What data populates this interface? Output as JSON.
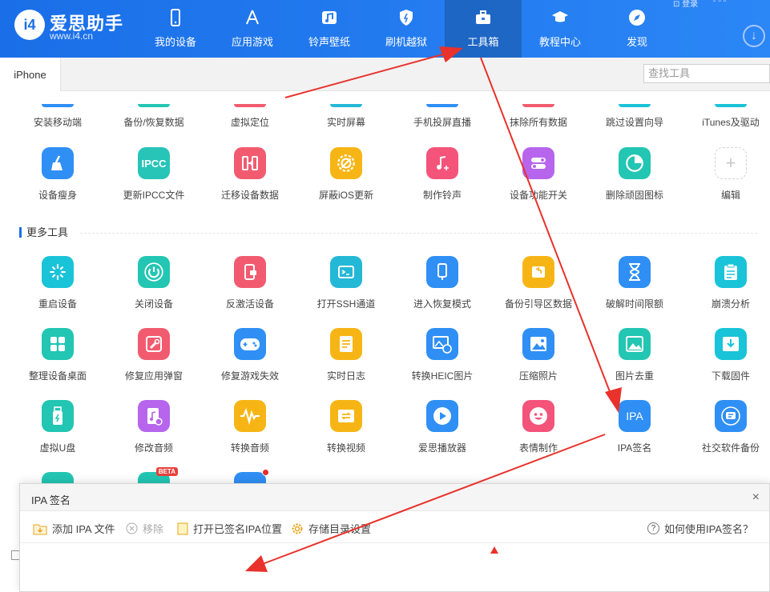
{
  "app": {
    "logo_mark": "i4",
    "name": "爱思助手",
    "url": "www.i4.cn",
    "top_right_text": "登录"
  },
  "nav": [
    {
      "label": "我的设备",
      "icon": "phone-icon"
    },
    {
      "label": "应用游戏",
      "icon": "appstore-icon"
    },
    {
      "label": "铃声壁纸",
      "icon": "music-icon"
    },
    {
      "label": "刷机越狱",
      "icon": "shield-icon"
    },
    {
      "label": "工具箱",
      "icon": "toolbox-icon",
      "active": true
    },
    {
      "label": "教程中心",
      "icon": "graduation-cap-icon"
    },
    {
      "label": "发现",
      "icon": "compass-icon"
    }
  ],
  "tabs": {
    "device_tab": "iPhone",
    "search_placeholder": "查找工具"
  },
  "tools_row0": [
    "安装移动端",
    "备份/恢复数据",
    "虚拟定位",
    "实时屏幕",
    "手机投屏直播",
    "抹除所有数据",
    "跳过设置向导",
    "iTunes及驱动"
  ],
  "tools_row1": [
    {
      "label": "设备瘦身",
      "icon": "broom-icon",
      "color": "#2f8ff5"
    },
    {
      "label": "更新IPCC文件",
      "icon": "ipcc-icon",
      "text": "IPCC",
      "color": "#27c4b8"
    },
    {
      "label": "迁移设备数据",
      "icon": "transfer-icon",
      "color": "#f25b6f"
    },
    {
      "label": "屏蔽iOS更新",
      "icon": "block-update-icon",
      "color": "#f7b515"
    },
    {
      "label": "制作铃声",
      "icon": "ringtone-icon",
      "color": "#f4537a"
    },
    {
      "label": "设备功能开关",
      "icon": "toggle-icon",
      "color": "#b665ec"
    },
    {
      "label": "删除顽固图标",
      "icon": "pie-icon",
      "color": "#22c6b3"
    },
    {
      "label": "编辑",
      "icon": "plus-icon",
      "text": "+"
    }
  ],
  "section_title": "更多工具",
  "tools_row2": [
    {
      "label": "重启设备",
      "icon": "restart-icon",
      "color": "#19c3d8"
    },
    {
      "label": "关闭设备",
      "icon": "power-icon",
      "color": "#22c6b3"
    },
    {
      "label": "反激活设备",
      "icon": "deactivate-icon",
      "color": "#f25b6f"
    },
    {
      "label": "打开SSH通道",
      "icon": "terminal-icon",
      "color": "#23b8d6"
    },
    {
      "label": "进入恢复模式",
      "icon": "recovery-icon",
      "color": "#2f8ff5"
    },
    {
      "label": "备份引导区数据",
      "icon": "backup-boot-icon",
      "color": "#f7b515"
    },
    {
      "label": "破解时间限额",
      "icon": "hourglass-icon",
      "color": "#2f8ff5"
    },
    {
      "label": "崩溃分析",
      "icon": "clipboard-icon",
      "color": "#19c3d8"
    }
  ],
  "tools_row3": [
    {
      "label": "整理设备桌面",
      "icon": "grid-icon",
      "color": "#22c6b3"
    },
    {
      "label": "修复应用弹窗",
      "icon": "wrench-icon",
      "color": "#f25b6f"
    },
    {
      "label": "修复游戏失效",
      "icon": "gamepad-icon",
      "color": "#2f8ff5"
    },
    {
      "label": "实时日志",
      "icon": "log-icon",
      "color": "#f7b515"
    },
    {
      "label": "转换HEIC图片",
      "icon": "heic-icon",
      "color": "#2f8ff5"
    },
    {
      "label": "压缩照片",
      "icon": "photo-compress-icon",
      "color": "#2f8ff5"
    },
    {
      "label": "图片去重",
      "icon": "photo-dedupe-icon",
      "color": "#22c6b3"
    },
    {
      "label": "下载固件",
      "icon": "firmware-download-icon",
      "color": "#19c3d8"
    }
  ],
  "tools_row4": [
    {
      "label": "虚拟U盘",
      "icon": "usb-icon",
      "color": "#22c6b3"
    },
    {
      "label": "修改音频",
      "icon": "audio-edit-icon",
      "color": "#b665ec"
    },
    {
      "label": "转换音频",
      "icon": "waveform-icon",
      "color": "#f7b515"
    },
    {
      "label": "转换视频",
      "icon": "video-convert-icon",
      "color": "#f7b515"
    },
    {
      "label": "爱思播放器",
      "icon": "play-icon",
      "color": "#2f8ff5"
    },
    {
      "label": "表情制作",
      "icon": "emoji-icon",
      "color": "#f4537a"
    },
    {
      "label": "IPA签名",
      "icon": "ipa-icon",
      "text": "IPA",
      "color": "#2f8ff5"
    },
    {
      "label": "社交软件备份",
      "icon": "chat-backup-icon",
      "color": "#2f8ff5"
    }
  ],
  "tools_row5": [
    {
      "icon": "partial-tool-icon",
      "color": "#22c6b3"
    },
    {
      "icon": "partial-tool-icon",
      "color": "#22c6b3",
      "badge": "BETA"
    },
    {
      "icon": "partial-tool-icon",
      "color": "#2f8ff5",
      "dot": true
    }
  ],
  "dialog": {
    "title": "IPA 签名",
    "add_ipa": "添加 IPA 文件",
    "remove": "移除",
    "open_signed": "打开已签名IPA位置",
    "storage_settings": "存储目录设置",
    "help": "如何使用IPA签名？"
  },
  "colors": {
    "accent": "#1a6fe8",
    "annotation": "#e8322b"
  }
}
